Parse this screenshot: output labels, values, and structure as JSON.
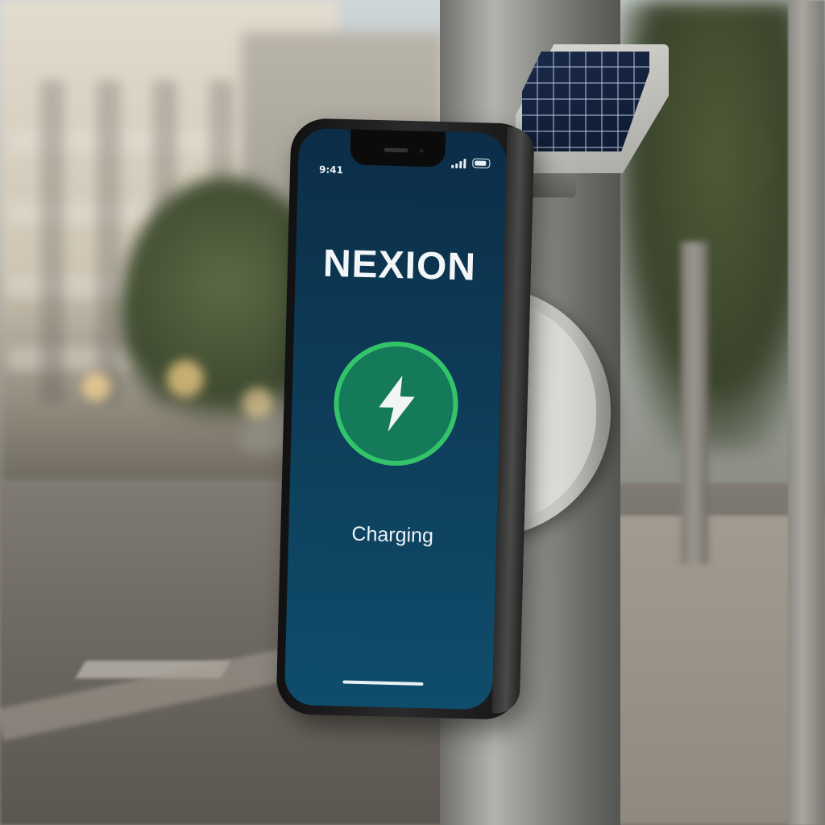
{
  "screen": {
    "status_bar": {
      "time": "9:41",
      "signal_icon": "cellular-signal-icon",
      "battery_icon": "battery-icon"
    },
    "brand_name": "NEXION",
    "charge_icon": "lightning-bolt-icon",
    "status_text": "Charging"
  },
  "colors": {
    "screen_gradient_top": "#0c2d47",
    "screen_gradient_bottom": "#0f4d6c",
    "ring_green": "#33c46a",
    "ring_fill": "#157a5a"
  }
}
